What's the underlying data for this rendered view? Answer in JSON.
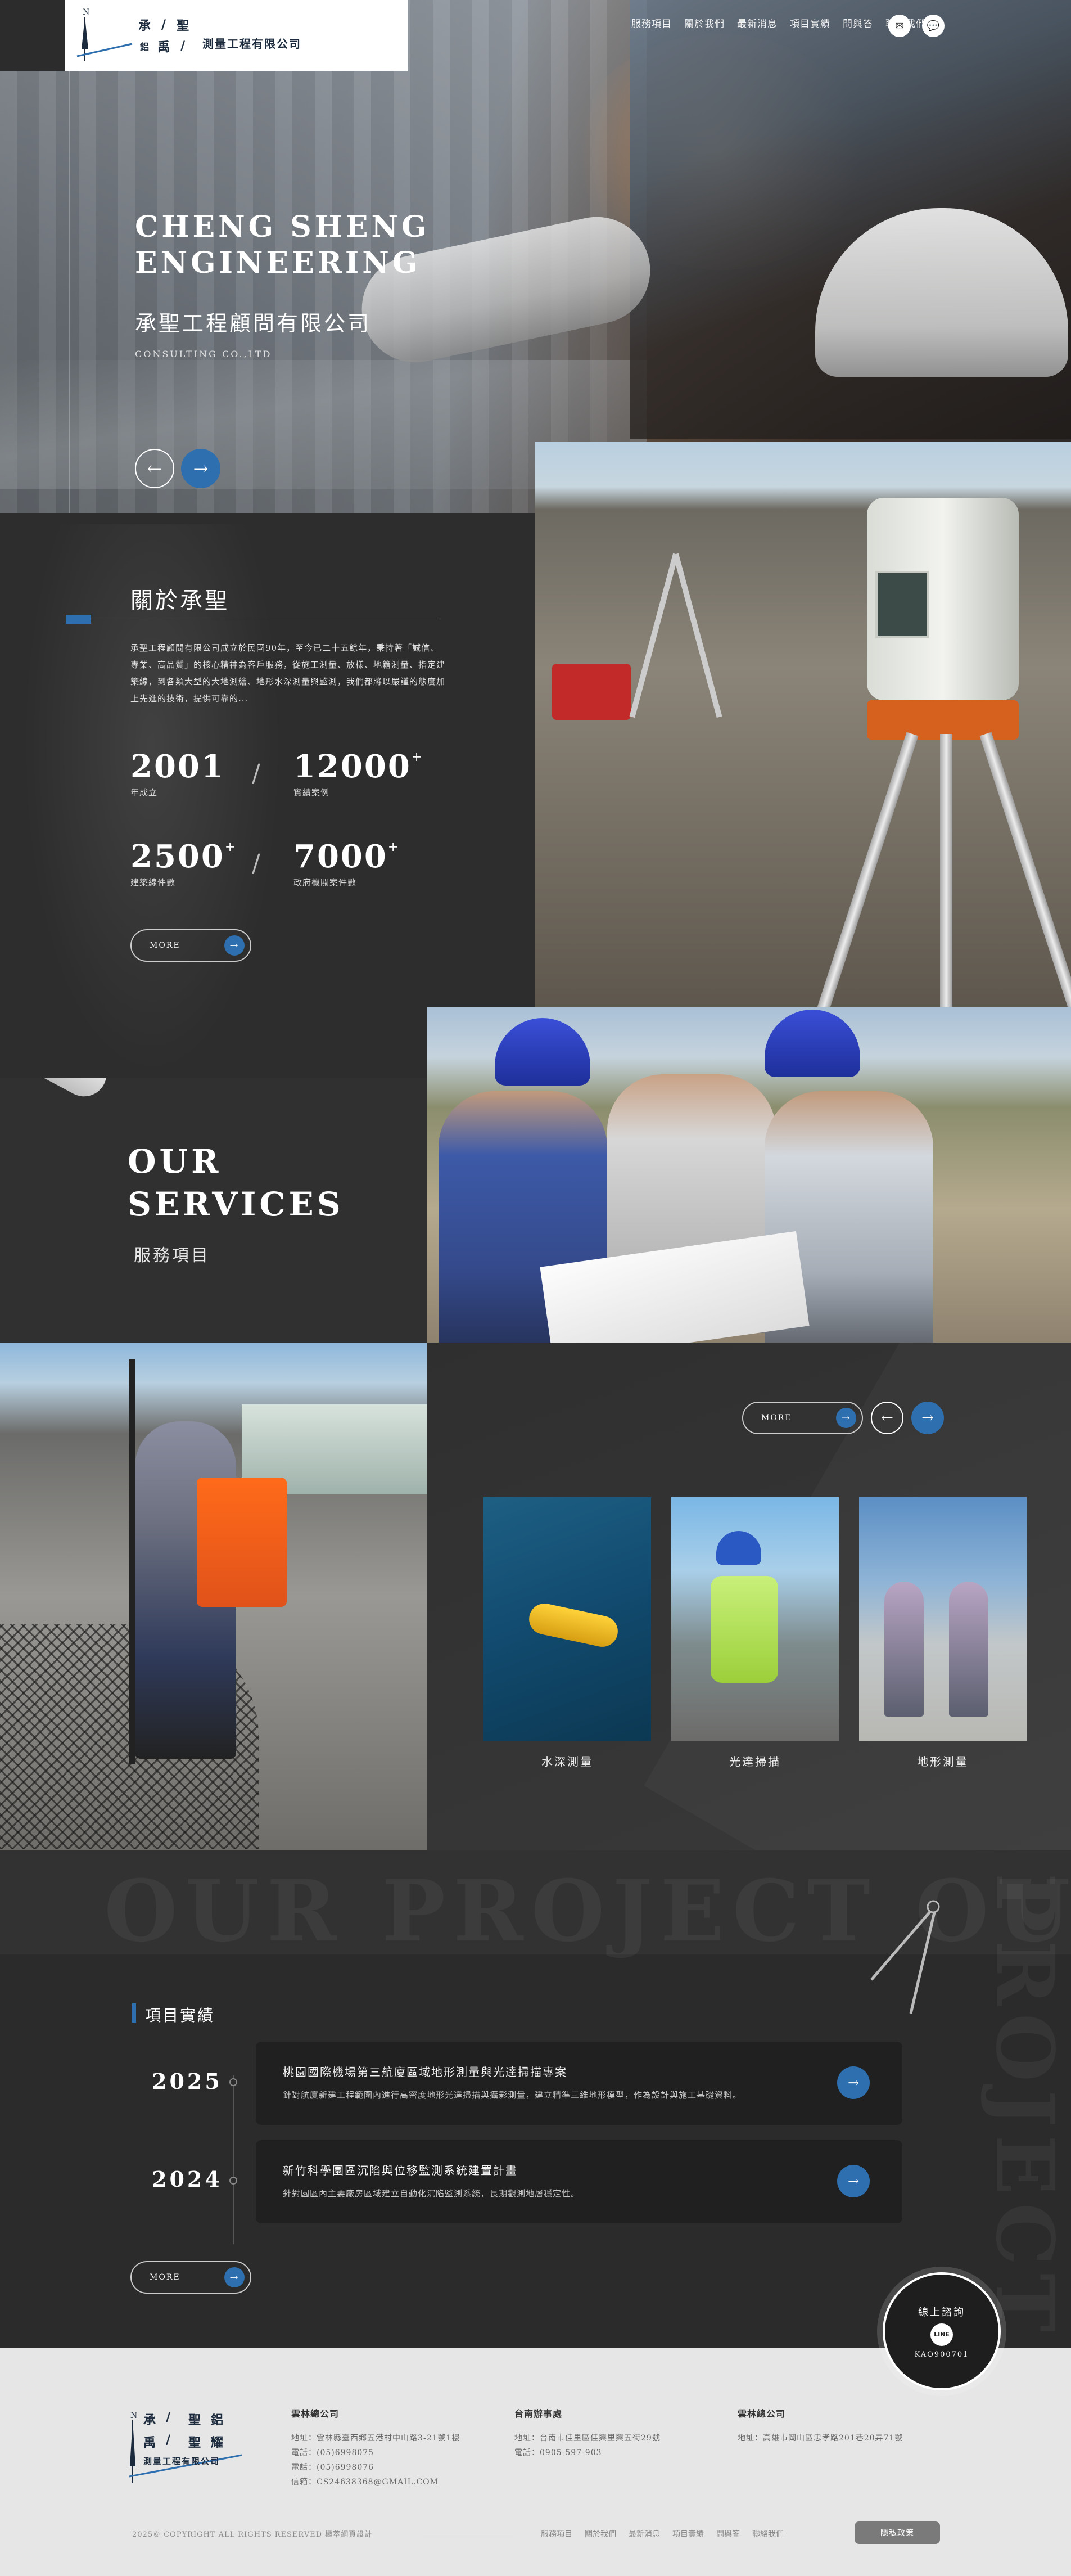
{
  "header": {
    "logo_chars": [
      "承",
      "/",
      "聖",
      "鋁",
      "禹",
      "/",
      "聖",
      "耀"
    ],
    "logo_sub": "測量工程有限公司",
    "nav": [
      "服務項目",
      "關於我們",
      "最新消息",
      "項目實績",
      "問與答",
      "聯絡我們"
    ],
    "icons": [
      "mail-icon",
      "line-icon"
    ]
  },
  "hero": {
    "title_line1": "CHENG SHENG",
    "title_line2": "ENGINEERING",
    "title_cn": "承聖工程顧問有限公司",
    "subtitle": "CONSULTING CO.,LTD",
    "prev": "←",
    "next": "→"
  },
  "about": {
    "title": "關於承聖",
    "paragraph": "承聖工程顧問有限公司成立於民國90年，至今已二十五餘年，秉持著「誠信、專業、高品質」的核心精神為客戶服務，從施工測量、放樣、地籍測量、指定建築線，到各類大型的大地測繪、地形水深測量與監測，我們都將以嚴謹的態度加上先進的技術，提供可靠的...",
    "stats": [
      {
        "num": "2001",
        "plus": "",
        "label": "年成立"
      },
      {
        "num": "12000",
        "plus": "+",
        "label": "實績案例"
      },
      {
        "num": "2500",
        "plus": "+",
        "label": "建築線件數"
      },
      {
        "num": "7000",
        "plus": "+",
        "label": "政府機關案件數"
      }
    ],
    "slash": "/",
    "more": "MORE",
    "more_icon": "→"
  },
  "services": {
    "title_line1": "OUR",
    "title_line2": "SERVICES",
    "title_cn": "服務項目",
    "more": "MORE",
    "more_icon": "→",
    "prev": "←",
    "next": "→",
    "cards": [
      {
        "label": "水深測量"
      },
      {
        "label": "光達掃描"
      },
      {
        "label": "地形測量"
      }
    ]
  },
  "project": {
    "bg_text": "OUR PROJECT OUR",
    "bg_vertical": "PROJECT",
    "title": "項目實績",
    "items": [
      {
        "year": "2025",
        "title": "桃園國際機場第三航廈區域地形測量與光達掃描專案",
        "desc": "針對航廈新建工程範圍內進行高密度地形光達掃描與攝影測量，建立精準三維地形模型，作為設計與施工基礎資料。",
        "go": "→"
      },
      {
        "year": "2024",
        "title": "新竹科學園區沉陷與位移監測系統建置計畫",
        "desc": "針對園區內主要廠房區域建立自動化沉陷監測系統，長期觀測地層穩定性。",
        "go": "→"
      }
    ],
    "more": "MORE",
    "more_icon": "→"
  },
  "line_badge": {
    "title": "線上諮詢",
    "icon": "LINE",
    "id": "KAO900701"
  },
  "footer": {
    "columns": [
      {
        "title": "雲林總公司",
        "lines": [
          "地址：雲林縣臺西鄉五港村中山路3-21號1樓",
          "電話：(05)6998075",
          "電話：(05)6998076",
          "信箱：CS24638368@GMAIL.COM"
        ]
      },
      {
        "title": "台南辦事處",
        "lines": [
          "地址：台南市佳里區佳興里興五街29號",
          "電話：0905-597-903"
        ]
      },
      {
        "title": "雲林總公司",
        "lines": [
          "地址：高雄市岡山區忠孝路201巷20弄71號"
        ]
      }
    ],
    "copyright": "2025© COPYRIGHT ALL RIGHTS RESERVED 極萃網頁設計",
    "nav": [
      "服務項目",
      "關於我們",
      "最新消息",
      "項目實績",
      "問與答",
      "聯絡我們"
    ],
    "privacy": "隱私政策"
  }
}
